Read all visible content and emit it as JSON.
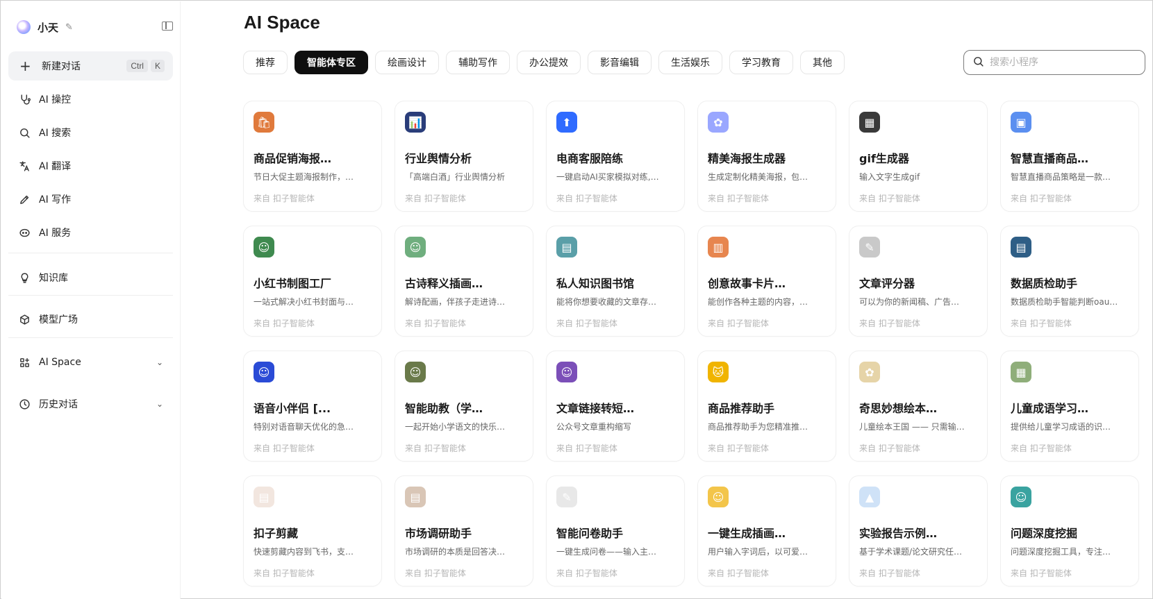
{
  "sidebar": {
    "user_name": "小天",
    "new_chat": {
      "label": "新建对话",
      "shortcut": [
        "Ctrl",
        "K"
      ]
    },
    "nav": [
      {
        "label": "AI 操控",
        "icon": "stethoscope-icon"
      },
      {
        "label": "AI 搜索",
        "icon": "search-icon"
      },
      {
        "label": "AI 翻译",
        "icon": "translate-icon"
      },
      {
        "label": "AI 写作",
        "icon": "pen-icon"
      },
      {
        "label": "AI 服务",
        "icon": "service-icon"
      }
    ],
    "knowledge": {
      "label": "知识库",
      "icon": "bulb-icon"
    },
    "models": {
      "label": "模型广场",
      "icon": "cube-icon"
    },
    "space": {
      "label": "AI Space",
      "icon": "apps-icon"
    },
    "history": {
      "label": "历史对话",
      "icon": "clock-icon"
    }
  },
  "main": {
    "title": "AI Space",
    "tabs": [
      "推荐",
      "智能体专区",
      "绘画设计",
      "辅助写作",
      "办公提效",
      "影音编辑",
      "生活娱乐",
      "学习教育",
      "其他"
    ],
    "active_tab": "智能体专区",
    "search_placeholder": "搜索小程序"
  },
  "cards": [
    {
      "title": "商品促销海报…",
      "desc": "节日大促主题海报制作，…",
      "source": "来自 扣子智能体",
      "icon_color": "#e07a3c",
      "icon_glyph": "🛍"
    },
    {
      "title": "行业舆情分析",
      "desc": "「高端白酒」行业舆情分析",
      "source": "来自 扣子智能体",
      "icon_color": "#2a3d7a",
      "icon_glyph": "📊"
    },
    {
      "title": "电商客服陪练",
      "desc": "一键启动AI买家模拟对练,…",
      "source": "来自 扣子智能体",
      "icon_color": "#2f6bff",
      "icon_glyph": "⬆"
    },
    {
      "title": "精美海报生成器",
      "desc": "生成定制化精美海报，包…",
      "source": "来自 扣子智能体",
      "icon_color": "#9aa7ff",
      "icon_glyph": "✿"
    },
    {
      "title": "gif生成器",
      "desc": "输入文字生成gif",
      "source": "来自 扣子智能体",
      "icon_color": "#3a3a3a",
      "icon_glyph": "▦"
    },
    {
      "title": "智慧直播商品…",
      "desc": "智慧直播商品策略是一款…",
      "source": "来自 扣子智能体",
      "icon_color": "#5b8ff0",
      "icon_glyph": "▣"
    },
    {
      "title": "小红书制图工厂",
      "desc": "一站式解决小红书封面与…",
      "source": "来自 扣子智能体",
      "icon_color": "#3f8a4f",
      "icon_glyph": "☺"
    },
    {
      "title": "古诗释义插画…",
      "desc": "解诗配画，伴孩子走进诗…",
      "source": "来自 扣子智能体",
      "icon_color": "#6fae7e",
      "icon_glyph": "☺"
    },
    {
      "title": "私人知识图书馆",
      "desc": "能将你想要收藏的文章存…",
      "source": "来自 扣子智能体",
      "icon_color": "#5a9fa8",
      "icon_glyph": "▤"
    },
    {
      "title": "创意故事卡片…",
      "desc": "能创作各种主题的内容，…",
      "source": "来自 扣子智能体",
      "icon_color": "#e7864f",
      "icon_glyph": "▥"
    },
    {
      "title": "文章评分器",
      "desc": "可以为你的新闻稿、广告…",
      "source": "来自 扣子智能体",
      "icon_color": "#c9c9c9",
      "icon_glyph": "✎"
    },
    {
      "title": "数据质检助手",
      "desc": "数据质检助手智能判断oau…",
      "source": "来自 扣子智能体",
      "icon_color": "#2e5e86",
      "icon_glyph": "▤"
    },
    {
      "title": "语音小伴侣 [...",
      "desc": "特别对语音聊天优化的急…",
      "source": "来自 扣子智能体",
      "icon_color": "#2a4bd6",
      "icon_glyph": "☺"
    },
    {
      "title": "智能助教（学…",
      "desc": "一起开始小学语文的快乐…",
      "source": "来自 扣子智能体",
      "icon_color": "#6a7a4a",
      "icon_glyph": "☺"
    },
    {
      "title": "文章链接转短…",
      "desc": "公众号文章重构缩写",
      "source": "来自 扣子智能体",
      "icon_color": "#7b4fb8",
      "icon_glyph": "☺"
    },
    {
      "title": "商品推荐助手",
      "desc": "商品推荐助手为您精准推…",
      "source": "来自 扣子智能体",
      "icon_color": "#f0b400",
      "icon_glyph": "🐱"
    },
    {
      "title": "奇思妙想绘本…",
      "desc": "儿童绘本王国 —— 只需输…",
      "source": "来自 扣子智能体",
      "icon_color": "#e6d4a8",
      "icon_glyph": "✿"
    },
    {
      "title": "儿童成语学习…",
      "desc": "提供给儿童学习成语的识…",
      "source": "来自 扣子智能体",
      "icon_color": "#8fae7a",
      "icon_glyph": "▦"
    },
    {
      "title": "扣子剪藏",
      "desc": "快速剪藏内容到飞书，支…",
      "source": "来自 扣子智能体",
      "icon_color": "#f2e6df",
      "icon_glyph": "▤"
    },
    {
      "title": "市场调研助手",
      "desc": "市场调研的本质是回答决…",
      "source": "来自 扣子智能体",
      "icon_color": "#d9c6b6",
      "icon_glyph": "▤"
    },
    {
      "title": "智能问卷助手",
      "desc": "一键生成问卷——输入主…",
      "source": "来自 扣子智能体",
      "icon_color": "#e8e8e8",
      "icon_glyph": "✎"
    },
    {
      "title": "一键生成插画…",
      "desc": "用户输入字词后，以可爱…",
      "source": "来自 扣子智能体",
      "icon_color": "#f3c54a",
      "icon_glyph": "☺"
    },
    {
      "title": "实验报告示例…",
      "desc": "基于学术课题/论文研究任…",
      "source": "来自 扣子智能体",
      "icon_color": "#cfe2f7",
      "icon_glyph": "▲"
    },
    {
      "title": "问题深度挖掘",
      "desc": "问题深度挖掘工具，专注…",
      "source": "来自 扣子智能体",
      "icon_color": "#3aa3a0",
      "icon_glyph": "☺"
    }
  ]
}
